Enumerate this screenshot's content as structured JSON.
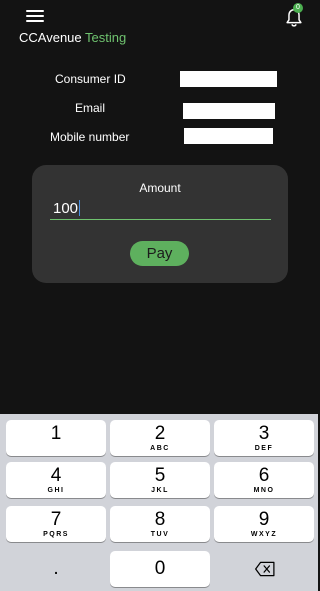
{
  "header": {
    "title_prefix": "CCAvenue",
    "title_suffix": "Testing",
    "notification_count": "0",
    "menu_icon": "hamburger-menu-icon",
    "bell_icon": "bell-icon"
  },
  "form": {
    "consumer_id_label": "Consumer ID",
    "consumer_id_value": "",
    "email_label": "Email",
    "email_value": "",
    "mobile_label": "Mobile number",
    "mobile_value": ""
  },
  "amount_card": {
    "label": "Amount",
    "value": "100",
    "pay_label": "Pay"
  },
  "keyboard": {
    "keys": [
      {
        "num": "1",
        "letters": ""
      },
      {
        "num": "2",
        "letters": "ABC"
      },
      {
        "num": "3",
        "letters": "DEF"
      },
      {
        "num": "4",
        "letters": "GHI"
      },
      {
        "num": "5",
        "letters": "JKL"
      },
      {
        "num": "6",
        "letters": "MNO"
      },
      {
        "num": "7",
        "letters": "PQRS"
      },
      {
        "num": "8",
        "letters": "TUV"
      },
      {
        "num": "9",
        "letters": "WXYZ"
      },
      {
        "num": ".",
        "letters": ""
      },
      {
        "num": "0",
        "letters": ""
      }
    ],
    "backspace_icon": "backspace-icon"
  },
  "colors": {
    "background": "#131313",
    "accent": "#6fc36f",
    "pay_button": "#5eb05e",
    "card": "#333333",
    "keyboard": "#d1d3d9"
  }
}
